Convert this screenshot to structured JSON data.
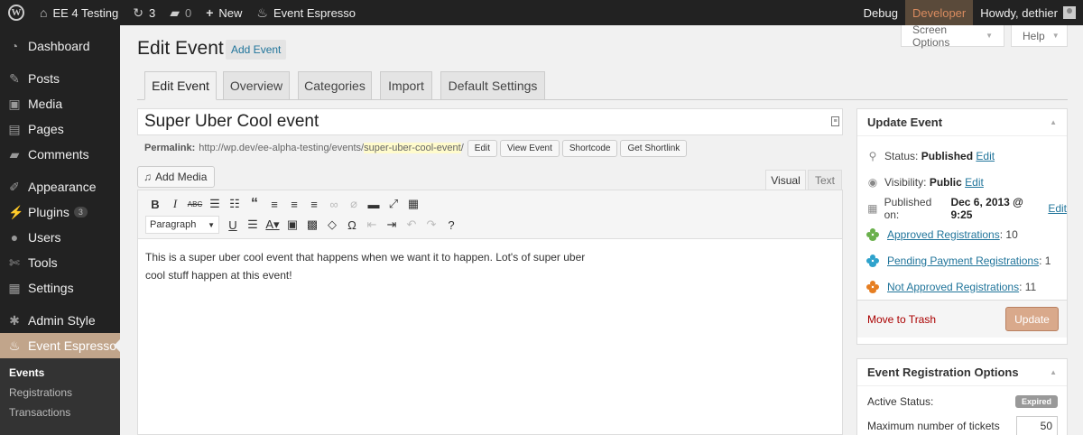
{
  "adminbar": {
    "site_name": "EE 4 Testing",
    "updates_count": "3",
    "comments_count": "0",
    "new_label": "New",
    "plugin_label": "Event Espresso",
    "debug_label": "Debug",
    "developer_label": "Developer",
    "howdy_label": "Howdy, dethier"
  },
  "sidebar": {
    "items": [
      {
        "label": "Dashboard",
        "icon": "dashboard-icon"
      },
      {
        "label": "Posts",
        "icon": "pin-icon"
      },
      {
        "label": "Media",
        "icon": "media-icon"
      },
      {
        "label": "Pages",
        "icon": "pages-icon"
      },
      {
        "label": "Comments",
        "icon": "comment-icon"
      },
      {
        "label": "Appearance",
        "icon": "brush-icon"
      },
      {
        "label": "Plugins",
        "icon": "plugin-icon",
        "badge": "3"
      },
      {
        "label": "Users",
        "icon": "user-icon"
      },
      {
        "label": "Tools",
        "icon": "wrench-icon"
      },
      {
        "label": "Settings",
        "icon": "settings-icon"
      },
      {
        "label": "Admin Style",
        "icon": "gear-icon"
      },
      {
        "label": "Event Espresso",
        "icon": "ee-icon"
      }
    ],
    "submenu": [
      "Events",
      "Registrations",
      "Transactions"
    ]
  },
  "screen_options": "Screen Options",
  "help": "Help",
  "page": {
    "title": "Edit Event",
    "add_new": "Add Event"
  },
  "tabs": [
    "Edit Event",
    "Overview",
    "Categories",
    "Import",
    "Default Settings"
  ],
  "post": {
    "title": "Super Uber Cool event",
    "permalink_label": "Permalink:",
    "permalink_base": "http://wp.dev/ee-alpha-testing/events/",
    "permalink_slug": "super-uber-cool-event",
    "permalink_end": "/",
    "buttons": [
      "Edit",
      "View Event",
      "Shortcode",
      "Get Shortlink"
    ]
  },
  "editor": {
    "add_media": "Add Media",
    "visual_tab": "Visual",
    "text_tab": "Text",
    "format_select": "Paragraph",
    "content_line1": "This is a super uber cool event that happens when we want it to happen.  Lot's of super uber",
    "content_line2": "cool stuff happen at this event!"
  },
  "update_box": {
    "title": "Update Event",
    "status_label": "Status:",
    "status_value": "Published",
    "visibility_label": "Visibility:",
    "visibility_value": "Public",
    "published_label": "Published on:",
    "published_value": "Dec 6, 2013 @ 9:25",
    "edit_link": "Edit",
    "approved_label": "Approved Registrations",
    "approved_count": ": 10",
    "pending_label": "Pending Payment Registrations",
    "pending_count": ": 1",
    "not_approved_label": "Not Approved Registrations",
    "not_approved_count": ": 11",
    "trash_label": "Move to Trash",
    "update_label": "Update"
  },
  "options_box": {
    "title": "Event Registration Options",
    "active_status_label": "Active Status:",
    "active_status_value": "Expired",
    "max_tickets_label": "Maximum number of tickets",
    "max_tickets_value": "50"
  },
  "colors": {
    "approved": "#6ab04c",
    "pending": "#2ea2cc",
    "not_approved": "#e67e22",
    "accent": "#c1a58b"
  }
}
